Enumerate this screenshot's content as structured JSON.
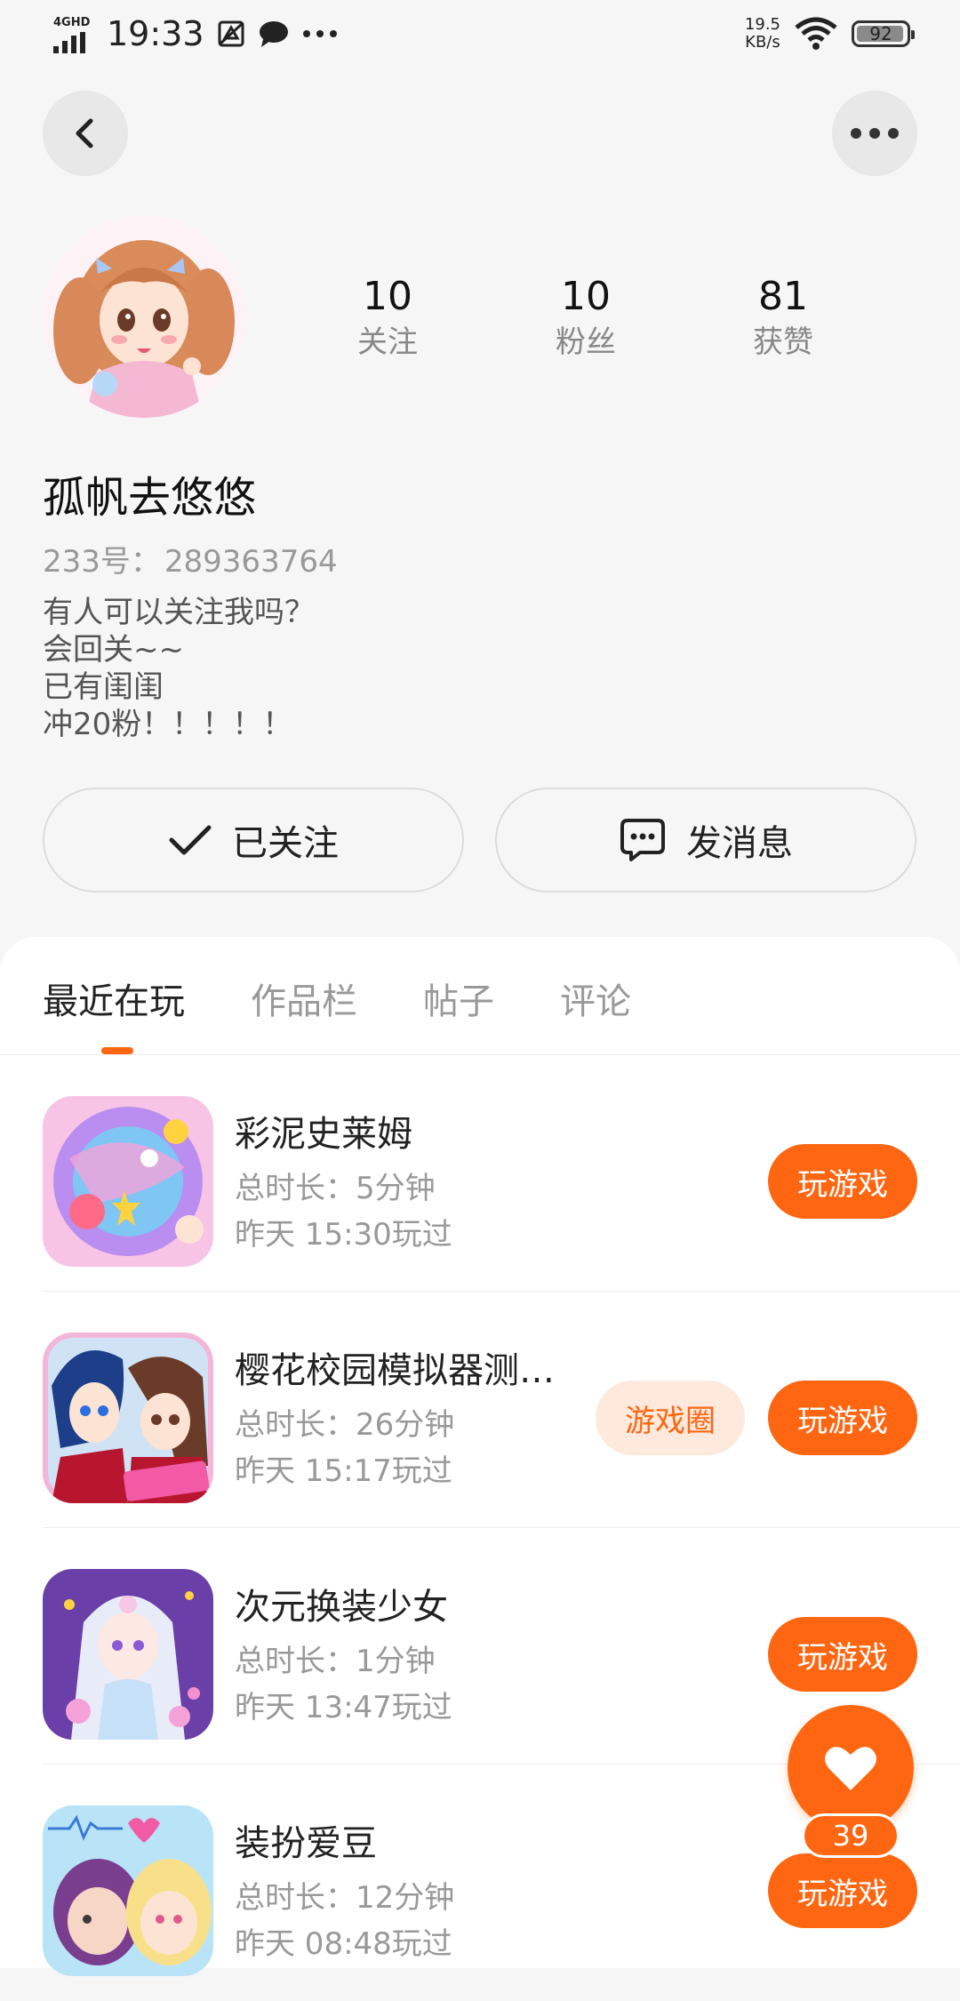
{
  "status_bar": {
    "network": "4GHD",
    "time": "19:33",
    "speed_value": "19.5",
    "speed_unit": "KB/s",
    "battery": "92",
    "icons": [
      "signal-icon",
      "notification-icon",
      "chat-bubble-icon",
      "more-dots-icon",
      "wifi-icon",
      "battery-icon"
    ]
  },
  "header": {
    "back_icon": "chevron-left-icon",
    "more_icon": "more-dots-icon"
  },
  "profile": {
    "stats": [
      {
        "value": "10",
        "label": "关注"
      },
      {
        "value": "10",
        "label": "粉丝"
      },
      {
        "value": "81",
        "label": "获赞"
      }
    ],
    "nickname": "孤帆去悠悠",
    "uid_label": "233号：",
    "uid_value": "289363764",
    "bio": [
      "有人可以关注我吗？",
      "会回关~~",
      "已有闺闺",
      "冲20粉！！！！！"
    ],
    "follow_button": "已关注",
    "message_button": "发消息"
  },
  "tabs": [
    {
      "label": "最近在玩",
      "active": true
    },
    {
      "label": "作品栏",
      "active": false
    },
    {
      "label": "帖子",
      "active": false
    },
    {
      "label": "评论",
      "active": false
    }
  ],
  "games": [
    {
      "name": "彩泥史莱姆",
      "duration": "总时长：5分钟",
      "last_played": "昨天 15:30玩过",
      "play_label": "玩游戏",
      "circle_label": ""
    },
    {
      "name": "樱花校园模拟器测…",
      "duration": "总时长：26分钟",
      "last_played": "昨天 15:17玩过",
      "play_label": "玩游戏",
      "circle_label": "游戏圈"
    },
    {
      "name": "次元换装少女",
      "duration": "总时长：1分钟",
      "last_played": "昨天 13:47玩过",
      "play_label": "玩游戏",
      "circle_label": ""
    },
    {
      "name": "装扮爱豆",
      "duration": "总时长：12分钟",
      "last_played": "昨天 08:48玩过",
      "play_label": "玩游戏",
      "circle_label": ""
    }
  ],
  "fab": {
    "icon": "heart-icon",
    "count": "39"
  },
  "colors": {
    "accent": "#ff6611",
    "accent_light": "#ffe9dc",
    "background": "#f6f6f6"
  }
}
